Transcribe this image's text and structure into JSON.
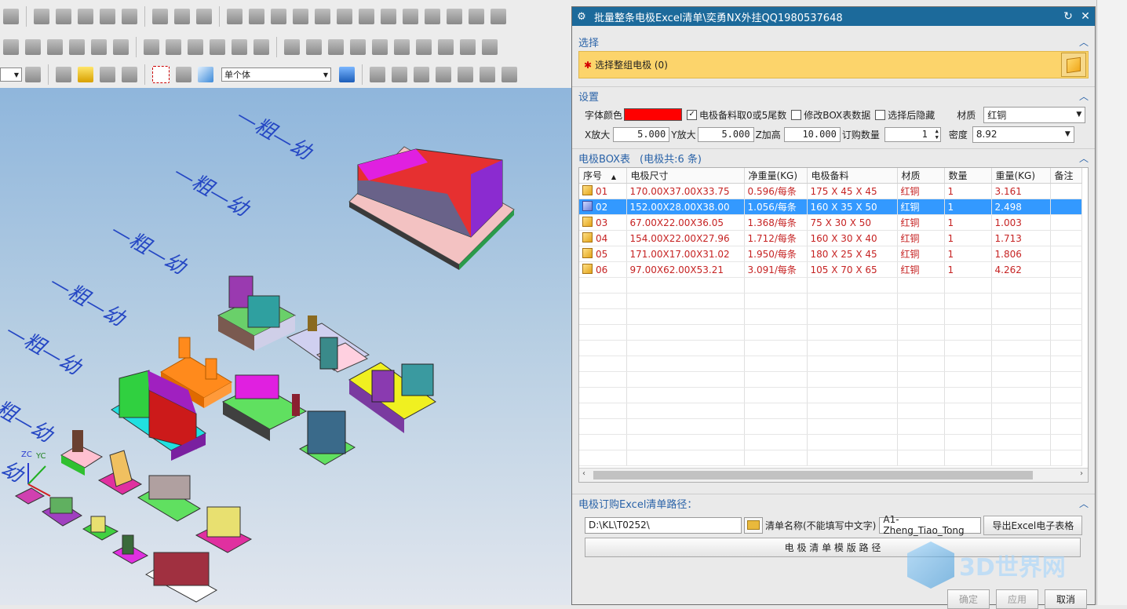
{
  "toolbar": {
    "selection_filter": "单个体"
  },
  "viewport": {
    "annotations": [
      "—粗—幼",
      "—粗—幼",
      "—粗—幼",
      "—粗—幼",
      "—粗—幼",
      "—粗—幼",
      "幼"
    ],
    "axis_labels": {
      "zc": "ZC",
      "yc": "YC"
    }
  },
  "dialog": {
    "title": "批量整条电极Excel清单\\奕勇NX外挂QQ1980537648",
    "sections": {
      "select": {
        "header": "选择",
        "prompt": "选择整组电极 (0)"
      },
      "settings": {
        "header": "设置",
        "font_color_label": "字体颜色",
        "font_color": "#ff0000",
        "opt_round": "电极备料取0或5尾数",
        "opt_modify": "修改BOX表数据",
        "opt_hide": "选择后隐藏",
        "material_label": "材质",
        "material_value": "红铜",
        "x_label": "X放大",
        "x_value": "5.000",
        "y_label": "Y放大",
        "y_value": "5.000",
        "z_label": "Z加高",
        "z_value": "10.000",
        "qty_label": "订购数量",
        "qty_value": "1",
        "density_label": "密度",
        "density_value": "8.92"
      },
      "box_table": {
        "header": "电极BOX表",
        "count_text": "(电极共:6 条)",
        "columns": [
          "序号",
          "电极尺寸",
          "净重量(KG)",
          "电极备料",
          "材质",
          "数量",
          "重量(KG)",
          "备注"
        ],
        "rows": [
          [
            "01",
            "170.00X37.00X33.75",
            "0.596/每条",
            "175 X 45 X 45",
            "红铜",
            "1",
            "3.161",
            ""
          ],
          [
            "02",
            "152.00X28.00X38.00",
            "1.056/每条",
            "160 X 35 X 50",
            "红铜",
            "1",
            "2.498",
            ""
          ],
          [
            "03",
            "67.00X22.00X36.05",
            "1.368/每条",
            "75 X 30 X 50",
            "红铜",
            "1",
            "1.003",
            ""
          ],
          [
            "04",
            "154.00X22.00X27.96",
            "1.712/每条",
            "160 X 30 X 40",
            "红铜",
            "1",
            "1.713",
            ""
          ],
          [
            "05",
            "171.00X17.00X31.02",
            "1.950/每条",
            "180 X 25 X 45",
            "红铜",
            "1",
            "1.806",
            ""
          ],
          [
            "06",
            "97.00X62.00X53.21",
            "3.091/每条",
            "105 X 70 X 65",
            "红铜",
            "1",
            "4.262",
            ""
          ]
        ],
        "selected_row": 1
      },
      "excel_path": {
        "header": "电极订购Excel清单路径：",
        "path_value": "D:\\KL\\T0252\\",
        "list_name_label": "清单名称(不能填写中文字)",
        "list_name_value": "A1-Zheng_Tiao_Tong",
        "export_button": "导出Excel电子表格",
        "template_button": "电 极 清 单 模 版 路 径"
      }
    },
    "footer": {
      "ok": "确定",
      "apply": "应用",
      "cancel": "取消"
    }
  },
  "watermark": "3D世界网"
}
